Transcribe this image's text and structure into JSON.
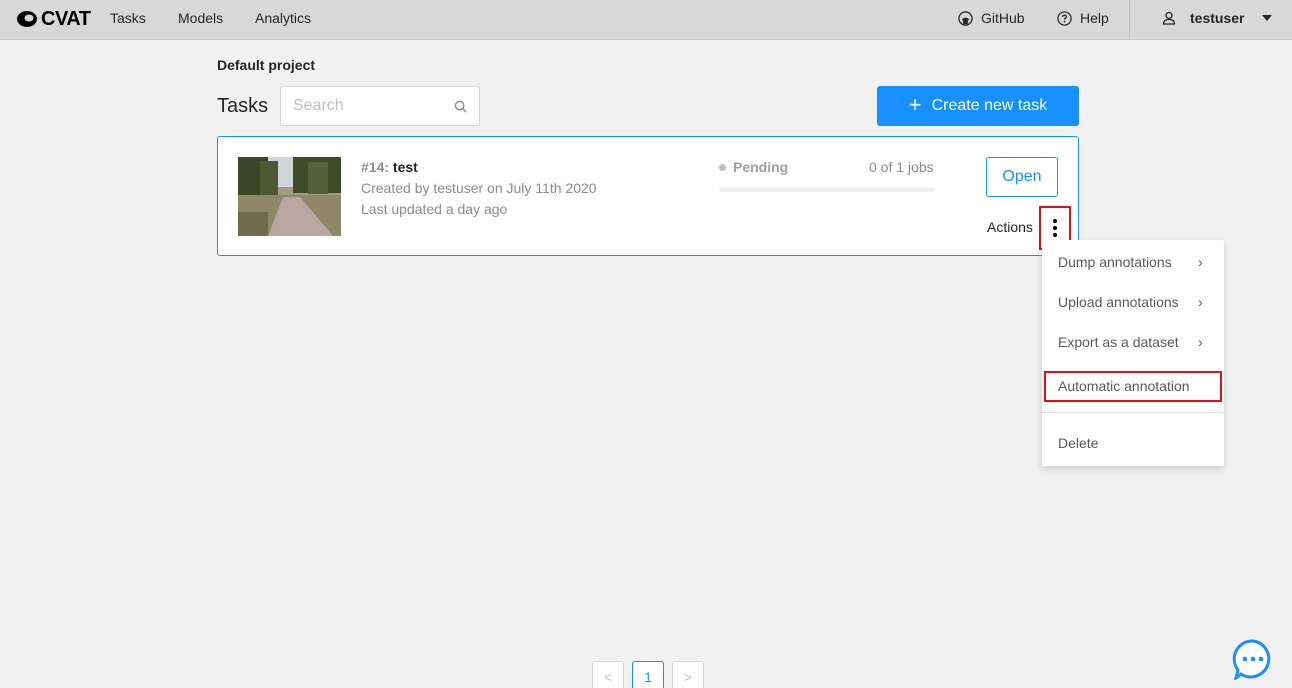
{
  "header": {
    "logo_text": "CVAT",
    "nav": [
      "Tasks",
      "Models",
      "Analytics"
    ],
    "github": "GitHub",
    "help": "Help",
    "username": "testuser"
  },
  "main": {
    "project_title": "Default project",
    "tasks_title": "Tasks",
    "search_placeholder": "Search",
    "create_button": "Create new task"
  },
  "task": {
    "id_label": "#14:",
    "name": "test",
    "created": "Created by testuser on July 11th 2020",
    "updated": "Last updated a day ago",
    "status": "Pending",
    "jobs": "0 of 1 jobs",
    "progress": 0,
    "open_button": "Open",
    "actions_label": "Actions"
  },
  "actions_menu": {
    "dump": "Dump annotations",
    "upload": "Upload annotations",
    "export": "Export as a dataset",
    "auto": "Automatic annotation",
    "delete": "Delete"
  },
  "pagination": {
    "current": "1",
    "prev": "<",
    "next": ">"
  },
  "colors": {
    "accent": "#1890ff",
    "highlight": "#e0101a",
    "header_bg": "#d8d8d8"
  }
}
